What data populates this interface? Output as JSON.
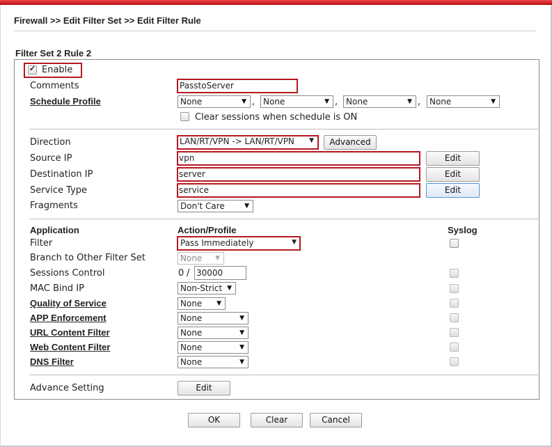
{
  "breadcrumb": "Firewall >> Edit Filter Set >> Edit Filter Rule",
  "set_title": "Filter Set 2 Rule 2",
  "enable": {
    "label": "Enable",
    "checked": true
  },
  "comments": {
    "label": "Comments",
    "value": "PasstoServer"
  },
  "schedule": {
    "label": "Schedule Profile",
    "profiles": [
      "None",
      "None",
      "None",
      "None"
    ],
    "clear_label": "Clear sessions when schedule is ON",
    "clear_checked": false
  },
  "direction": {
    "label": "Direction",
    "value": "LAN/RT/VPN -> LAN/RT/VPN",
    "advanced_label": "Advanced"
  },
  "source_ip": {
    "label": "Source IP",
    "value": "vpn",
    "edit_label": "Edit"
  },
  "destination_ip": {
    "label": "Destination IP",
    "value": "server",
    "edit_label": "Edit"
  },
  "service_type": {
    "label": "Service Type",
    "value": "service",
    "edit_label": "Edit"
  },
  "fragments": {
    "label": "Fragments",
    "value": "Don't Care"
  },
  "headers": {
    "application": "Application",
    "action_profile": "Action/Profile",
    "syslog": "Syslog"
  },
  "filter": {
    "label": "Filter",
    "value": "Pass Immediately"
  },
  "branch": {
    "label": "Branch to Other Filter Set",
    "value": "None"
  },
  "sessions": {
    "label": "Sessions Control",
    "current": "0",
    "separator": "/",
    "max": "30000"
  },
  "mac_bind": {
    "label": "MAC Bind IP",
    "value": "Non-Strict"
  },
  "qos": {
    "label": "Quality of Service",
    "value": "None"
  },
  "app_enforcement": {
    "label": "APP Enforcement",
    "value": "None"
  },
  "url_filter": {
    "label": "URL Content Filter",
    "value": "None"
  },
  "web_filter": {
    "label": "Web Content Filter",
    "value": "None"
  },
  "dns_filter": {
    "label": "DNS Filter",
    "value": "None"
  },
  "advance": {
    "label": "Advance Setting",
    "edit_label": "Edit"
  },
  "footer": {
    "ok": "OK",
    "clear": "Clear",
    "cancel": "Cancel"
  },
  "colors": {
    "highlight": "#b5181f",
    "topbar": "#d21f25"
  },
  "icons": {
    "dropdown": "chevron-down-icon",
    "check": "check-icon"
  }
}
